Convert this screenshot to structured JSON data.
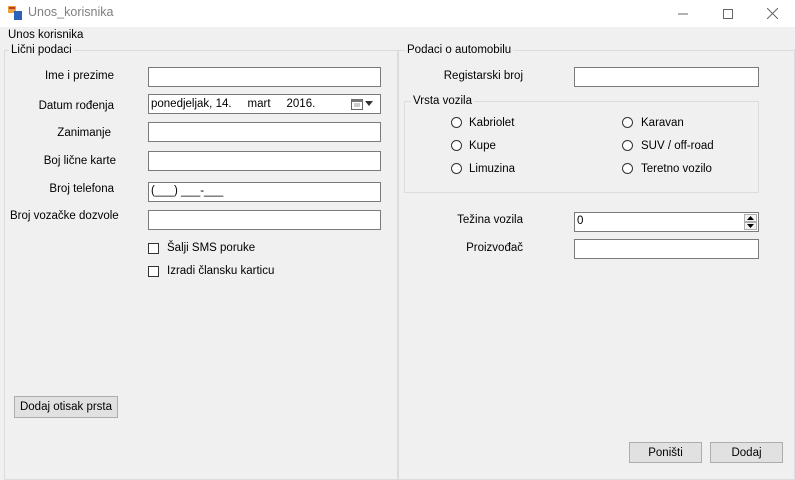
{
  "window": {
    "title": "Unos_korisnika",
    "form_label": "Unos korisnika"
  },
  "personal": {
    "group_title": "Lični podaci",
    "name_label": "Ime i prezime",
    "birth_label": "Datum rođenja",
    "birth_value": "ponedjeljak, 14.     mart     2016.",
    "occupation_label": "Zanimanje",
    "id_card_label": "Boj lične karte",
    "phone_label": "Broj telefona",
    "phone_mask": "(___) ___-___",
    "license_label": "Broj vozačke dozvole",
    "sms_label": "Šalji SMS poruke",
    "card_label": "Izradi člansku karticu",
    "fingerprint_button": "Dodaj otisak prsta"
  },
  "car": {
    "group_title": "Podaci o automobilu",
    "reg_label": "Registarski broj",
    "type_group_title": "Vrsta vozila",
    "types": [
      "Kabriolet",
      "Karavan",
      "Kupe",
      "SUV / off-road",
      "Limuzina",
      "Teretno vozilo"
    ],
    "weight_label": "Težina vozila",
    "weight_value": "0",
    "manufacturer_label": "Proizvođač"
  },
  "actions": {
    "reset": "Poništi",
    "add": "Dodaj"
  },
  "icons": {
    "app": "form-app-icon",
    "calendar": "calendar-icon",
    "dropdown": "chevron-down-icon"
  }
}
